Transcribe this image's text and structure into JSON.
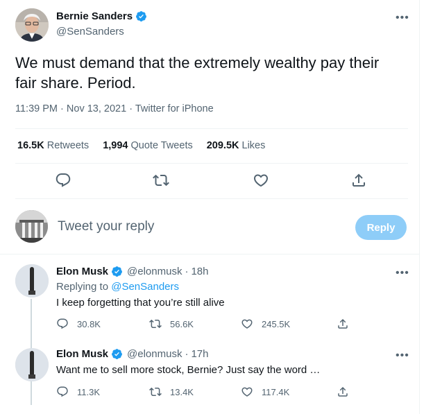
{
  "main_tweet": {
    "author_name": "Bernie Sanders",
    "author_handle": "@SenSanders",
    "text": "We must demand that the extremely wealthy pay their fair share. Period.",
    "time": "11:39 PM",
    "date": "Nov 13, 2021",
    "source": "Twitter for iPhone",
    "separator": "·",
    "retweets_count": "16.5K",
    "retweets_label": "Retweets",
    "quotes_count": "1,994",
    "quotes_label": "Quote Tweets",
    "likes_count": "209.5K",
    "likes_label": "Likes"
  },
  "reply_box": {
    "placeholder": "Tweet your reply",
    "button_label": "Reply"
  },
  "replies": [
    {
      "author_name": "Elon Musk",
      "author_handle": "@elonmusk",
      "separator": "·",
      "time": "18h",
      "replying_prefix": "Replying to",
      "replying_handle": "@SenSanders",
      "text": "I keep forgetting that you’re still alive",
      "reply_count": "30.8K",
      "retweet_count": "56.6K",
      "like_count": "245.5K"
    },
    {
      "author_name": "Elon Musk",
      "author_handle": "@elonmusk",
      "separator": "·",
      "time": "17h",
      "text": "Want me to sell more stock, Bernie? Just say the word …",
      "reply_count": "11.3K",
      "retweet_count": "13.4K",
      "like_count": "117.4K"
    }
  ],
  "more_label": "•••",
  "colors": {
    "accent": "#1d9bf0",
    "reply_button_disabled": "#8ecdf8",
    "secondary_text": "#536471",
    "primary_text": "#0f1419",
    "divider": "#eff3f4"
  },
  "icons": [
    "verified-badge-icon",
    "more-icon",
    "reply-icon",
    "retweet-icon",
    "like-icon",
    "share-icon"
  ]
}
